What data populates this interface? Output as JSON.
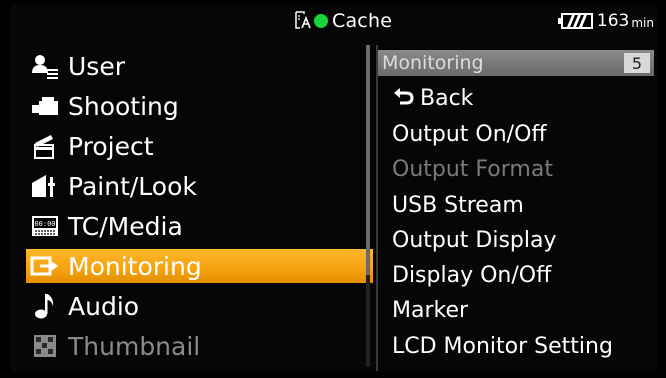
{
  "status_bar": {
    "cache_label": "Cache",
    "record_indicator_color": "#18d33a",
    "battery_value": "163",
    "battery_unit": "min",
    "icons": [
      "media-card-icon",
      "record-dot-icon",
      "battery-icon"
    ]
  },
  "main_menu": {
    "selected_index": 5,
    "accent_color": "#f5a20f",
    "items": [
      {
        "label": "User",
        "icon": "user-list-icon",
        "enabled": true
      },
      {
        "label": "Shooting",
        "icon": "camera-icon",
        "enabled": true
      },
      {
        "label": "Project",
        "icon": "clapper-icon",
        "enabled": true
      },
      {
        "label": "Paint/Look",
        "icon": "paint-look-icon",
        "enabled": true
      },
      {
        "label": "TC/Media",
        "icon": "timecode-icon",
        "enabled": true
      },
      {
        "label": "Monitoring",
        "icon": "monitor-output-icon",
        "enabled": true
      },
      {
        "label": "Audio",
        "icon": "music-note-icon",
        "enabled": true
      },
      {
        "label": "Thumbnail",
        "icon": "thumbnail-grid-icon",
        "enabled": false
      }
    ]
  },
  "sub_menu": {
    "title": "Monitoring",
    "page": "5",
    "back_label": "Back",
    "items": [
      {
        "label": "Output On/Off",
        "enabled": true
      },
      {
        "label": "Output Format",
        "enabled": false
      },
      {
        "label": "USB Stream",
        "enabled": true
      },
      {
        "label": "Output Display",
        "enabled": true
      },
      {
        "label": "Display On/Off",
        "enabled": true
      },
      {
        "label": "Marker",
        "enabled": true
      },
      {
        "label": "LCD Monitor Setting",
        "enabled": true
      }
    ]
  }
}
